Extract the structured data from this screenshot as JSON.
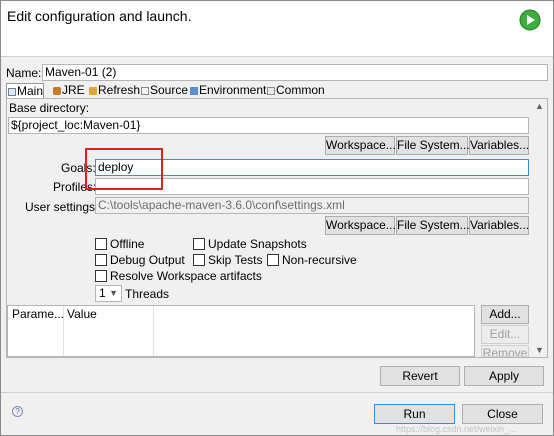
{
  "header": {
    "title": "Edit configuration and launch.",
    "run_icon": "run-play-icon",
    "accent": "#2ea12e"
  },
  "name": {
    "label": "Name:",
    "value": "Maven-01 (2)"
  },
  "tabs": [
    {
      "label": "Main",
      "icon": "main-tab-icon",
      "active": true
    },
    {
      "label": "JRE",
      "icon": "jre-tab-icon",
      "active": false
    },
    {
      "label": "Refresh",
      "icon": "refresh-tab-icon",
      "active": false
    },
    {
      "label": "Source",
      "icon": "source-tab-icon",
      "active": false
    },
    {
      "label": "Environment",
      "icon": "environment-tab-icon",
      "active": false
    },
    {
      "label": "Common",
      "icon": "common-tab-icon",
      "active": false
    }
  ],
  "main": {
    "base_dir_label": "Base directory:",
    "base_dir_value": "${project_loc:Maven-01}",
    "workspace_btn": "Workspace...",
    "filesystem_btn": "File System...",
    "variables_btn": "Variables...",
    "goals_label": "Goals:",
    "goals_value": "deploy",
    "profiles_label": "Profiles:",
    "profiles_value": "",
    "user_settings_label": "User settings:",
    "user_settings_value": "C:\\tools\\apache-maven-3.6.0\\conf\\settings.xml",
    "offline": "Offline",
    "update_snapshots": "Update Snapshots",
    "debug_output": "Debug Output",
    "skip_tests": "Skip Tests",
    "non_recursive": "Non-recursive",
    "resolve_workspace": "Resolve Workspace artifacts",
    "threads_value": "1",
    "threads_label": "Threads",
    "table_headers": [
      "Parame...",
      "Value"
    ],
    "add_btn": "Add...",
    "edit_btn": "Edit...",
    "remove_btn": "Remove"
  },
  "footer": {
    "revert": "Revert",
    "apply": "Apply",
    "run": "Run",
    "close": "Close",
    "help_icon": "help-icon",
    "watermark": "https://blog.csdn.net/weixin_..."
  },
  "colors": {
    "highlight_box": "#e02020",
    "focus_border": "#3c8bdc"
  }
}
